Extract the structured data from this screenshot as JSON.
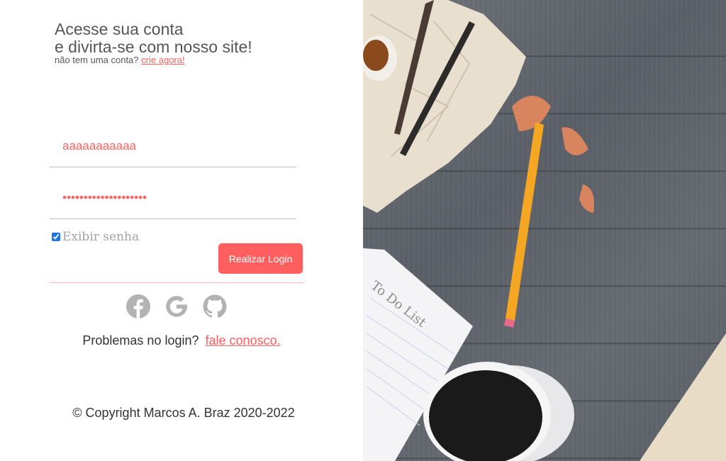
{
  "header": {
    "title_line1": "Acesse sua conta",
    "title_line2": "e divirta-se com nosso site!",
    "signup_prompt": "não tem uma conta?",
    "signup_link": "crie agora!"
  },
  "form": {
    "username_value": "aaaaaaaaaaa",
    "password_value": "aaaaaaaaaaaaaaaaaaaa",
    "show_password_label": "Exibir senha",
    "show_password_checked": true,
    "login_button": "Realizar Login"
  },
  "social": {
    "icons": [
      "facebook-icon",
      "google-icon",
      "github-icon"
    ],
    "icon_color": "#b3b3b3"
  },
  "help": {
    "prompt": "Problemas no login?",
    "link": "fale conosco."
  },
  "footer": {
    "copyright": "© Copyright Marcos A. Braz 2020-2022"
  },
  "colors": {
    "accent": "#ff5f5f",
    "text": "#555555"
  },
  "photo": {
    "notebook_text": "To Do List"
  }
}
